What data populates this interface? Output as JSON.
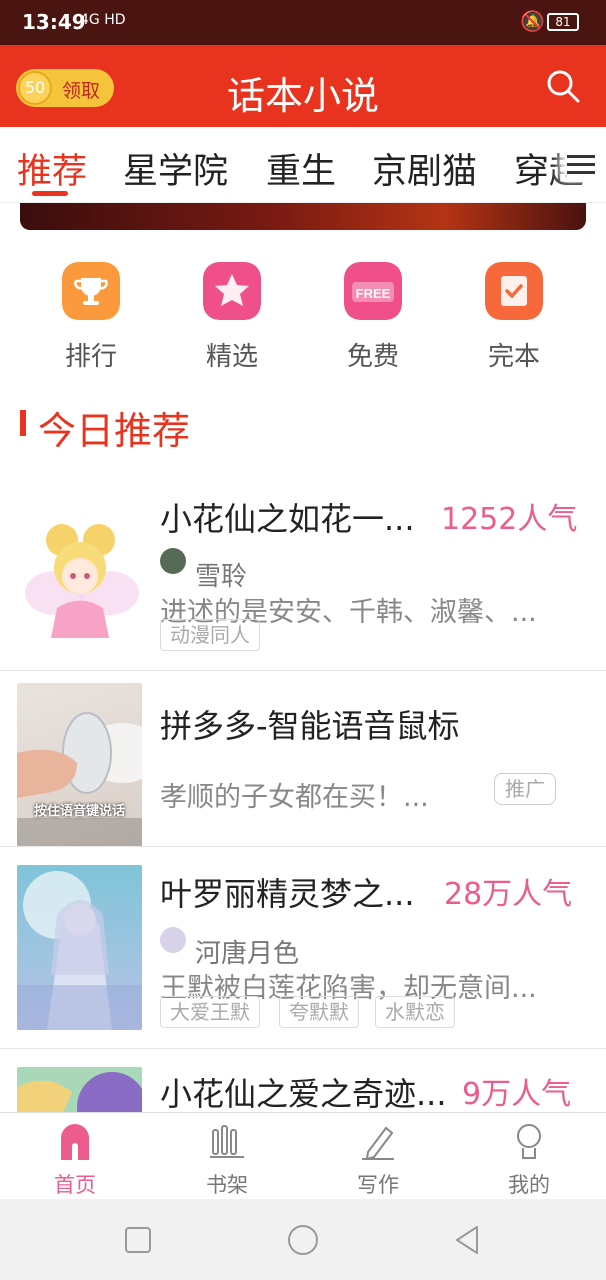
{
  "status_bar": {
    "time": "13:49",
    "network": "4G HD",
    "battery": "81"
  },
  "header": {
    "coin_amount": "50",
    "coin_action": "领取",
    "title": "话本小说"
  },
  "tabs": [
    "推荐",
    "星学院",
    "重生",
    "京剧猫",
    "穿越"
  ],
  "quick_links": [
    {
      "label": "排行",
      "icon": "trophy-icon"
    },
    {
      "label": "精选",
      "icon": "star-icon"
    },
    {
      "label": "免费",
      "icon": "free-icon"
    },
    {
      "label": "完本",
      "icon": "check-book-icon"
    }
  ],
  "free_badge": "FREE",
  "section_title": "今日推荐",
  "books": [
    {
      "title": "小花仙之如花一...",
      "popularity": "1252人气",
      "author": "雪聆",
      "desc": "进述的是安安、千韩、淑馨、...",
      "tags": [
        "动漫同人"
      ]
    },
    {
      "title": "叶罗丽精灵梦之...",
      "popularity": "28万人气",
      "author": "河唐月色",
      "desc": "王默被白莲花陷害，却无意间...",
      "tags": [
        "大爱王默",
        "夸默默",
        "水默恋"
      ]
    },
    {
      "title": "小花仙之爱之奇迹...",
      "popularity": "9万人气"
    }
  ],
  "ad": {
    "title": "拼多多-智能语音鼠标",
    "desc": "孝顺的子女都在买！...",
    "badge": "推广",
    "image_caption": "按住语音键说话"
  },
  "bottom_nav": [
    {
      "label": "首页",
      "active": true
    },
    {
      "label": "书架",
      "active": false
    },
    {
      "label": "写作",
      "active": false
    },
    {
      "label": "我的",
      "active": false
    }
  ],
  "colors": {
    "primary": "#e8341f",
    "pink": "#ec5c8d",
    "coin": "#f6c43a"
  }
}
